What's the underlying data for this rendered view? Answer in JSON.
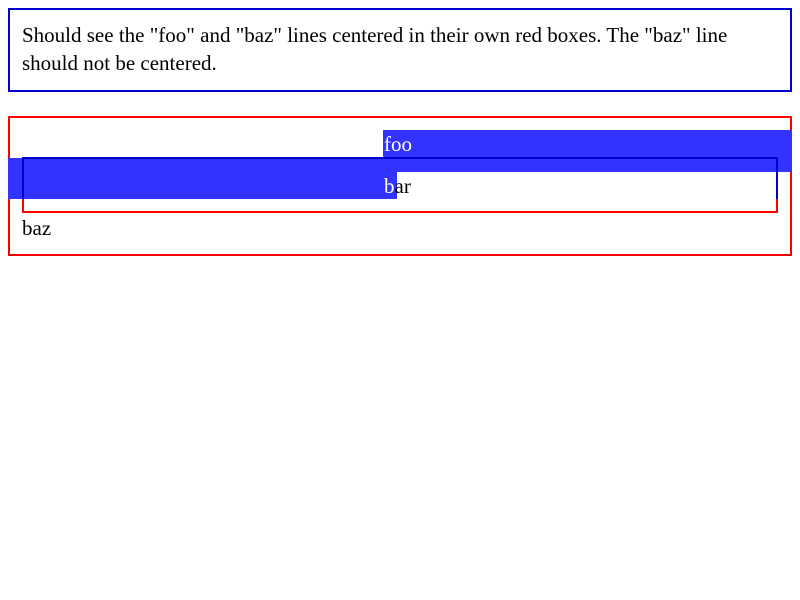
{
  "description": {
    "text": "Should see the \"foo\" and \"baz\" lines centered in their own red boxes. The \"baz\" line should not be centered."
  },
  "test": {
    "line1": "foo",
    "line2_first": "b",
    "line2_rest": "ar",
    "line3": "baz"
  },
  "colors": {
    "description_border": "#0000cc",
    "test_border": "#ff0000",
    "highlight": "#3333ff"
  }
}
